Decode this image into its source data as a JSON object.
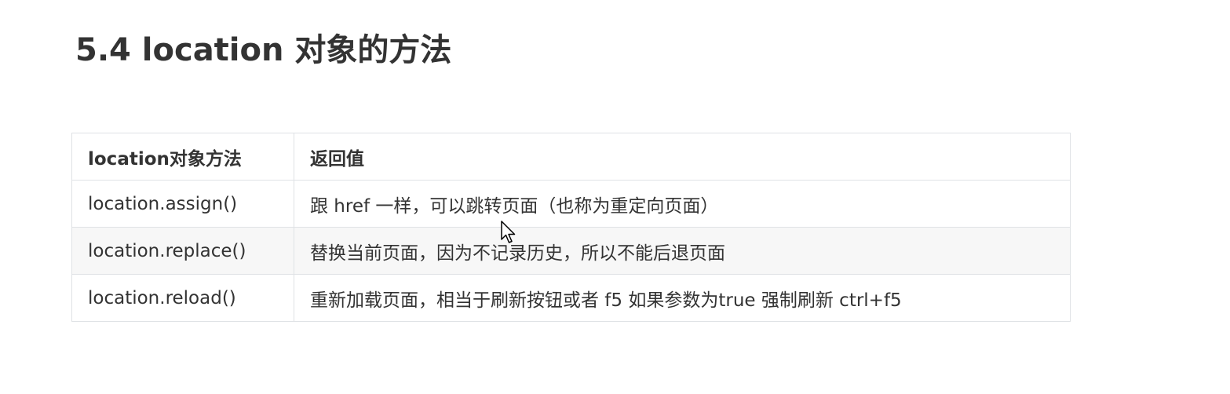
{
  "title": "5.4 location 对象的方法",
  "table": {
    "headers": [
      "location对象方法",
      "返回值"
    ],
    "rows": [
      [
        "location.assign()",
        "跟 href 一样，可以跳转页面（也称为重定向页面）"
      ],
      [
        "location.replace()",
        "替换当前页面，因为不记录历史，所以不能后退页面"
      ],
      [
        "location.reload()",
        "重新加载页面，相当于刷新按钮或者  f5  如果参数为true 强制刷新 ctrl+f5"
      ]
    ]
  },
  "cursor": {
    "icon": "mouse-pointer-icon"
  },
  "colors": {
    "text": "#333333",
    "border": "#dfe2e5",
    "stripe": "#f7f7f7",
    "background": "#ffffff"
  }
}
